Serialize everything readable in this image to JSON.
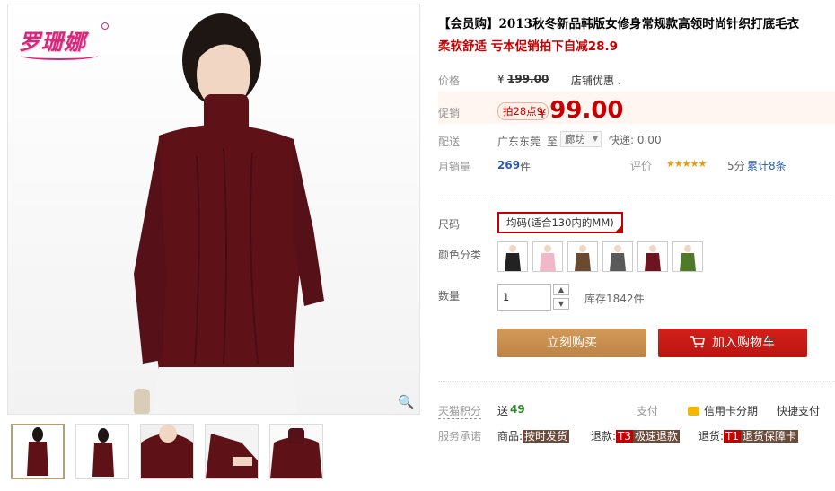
{
  "brand_logo_text": "罗珊娜",
  "title": "【会员购】2013秋冬新品韩版女修身常规款高领时尚针织打底毛衣",
  "subtitle": "柔软舒适 亏本促销拍下自减28.9",
  "price": {
    "label": "价格",
    "currency": "¥",
    "original": "199.00",
    "store_promo": "店铺优惠"
  },
  "promo": {
    "label": "促销",
    "tag": "拍28点9",
    "currency": "¥",
    "price": "99.00"
  },
  "shipping": {
    "label": "配送",
    "from": "广东东莞",
    "to_label": "至",
    "destination": "廊坊",
    "express": "快递: 0.00"
  },
  "sales": {
    "label": "月销量",
    "count": "269",
    "unit": "件",
    "rating_label": "评价",
    "stars": "★★★★★",
    "rating_value": 5,
    "score": "5分",
    "total_reviews": "累计8条"
  },
  "size": {
    "label": "尺码",
    "selected": "均码(适合130内的MM)"
  },
  "color": {
    "label": "颜色分类",
    "swatches": [
      "black",
      "pink",
      "brown",
      "grey",
      "wine",
      "green"
    ],
    "swatch_colors": [
      "#222222",
      "#f0b8c8",
      "#6b4a32",
      "#5a5a5a",
      "#6e1420",
      "#4f7a2a"
    ]
  },
  "quantity": {
    "label": "数量",
    "value": "1",
    "stock": "库存1842件"
  },
  "buttons": {
    "buy_now": "立刻购买",
    "add_to_cart": "加入购物车"
  },
  "points": {
    "label": "天猫积分",
    "prefix": "送",
    "value": "49",
    "pay_label": "支付",
    "credit": "信用卡分期",
    "quick_pay": "快捷支付"
  },
  "service": {
    "label": "服务承诺",
    "goods": "商品:",
    "goods_tag": "按时发货",
    "refund": "退款:",
    "refund_code": "T3",
    "refund_tag": "极速退款",
    "return": "退货:",
    "return_code": "T1",
    "return_tag": "退货保障卡"
  },
  "colors": {
    "accent_red": "#c40000",
    "buy_button": "#c48b4e",
    "sweater": "#5e1218"
  },
  "icons": [
    "zoom-icon",
    "chevron-down-icon",
    "cart-icon",
    "credit-card-icon",
    "stepper-up-icon",
    "stepper-down-icon"
  ]
}
